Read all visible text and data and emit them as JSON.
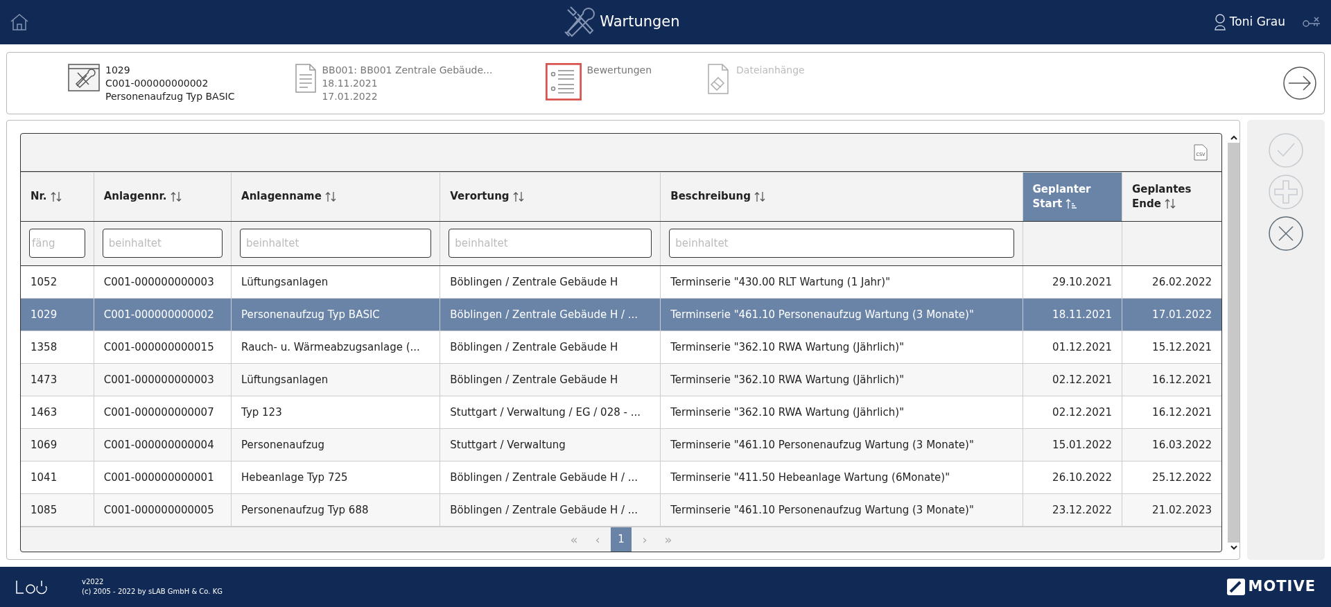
{
  "header": {
    "title": "Wartungen",
    "user": "Toni Grau"
  },
  "info_items": [
    {
      "kind": "record",
      "selected": false,
      "disabled": false,
      "lines": [
        "1029",
        "C001-000000000002",
        "Personenaufzug Typ BASIC"
      ]
    },
    {
      "kind": "document",
      "selected": false,
      "disabled": false,
      "lines": [
        "BB001: BB001 Zentrale Gebäude...",
        "18.11.2021",
        "17.01.2022"
      ]
    },
    {
      "kind": "ratings",
      "selected": true,
      "disabled": false,
      "lines": [
        "Bewertungen"
      ]
    },
    {
      "kind": "attachments",
      "selected": false,
      "disabled": true,
      "lines": [
        "Dateianhänge"
      ]
    }
  ],
  "table": {
    "export_label": "CSV",
    "columns": [
      {
        "label": "Nr.",
        "kind": "text",
        "sorted": false,
        "selected": false,
        "placeholder": "fäng"
      },
      {
        "label": "Anlagennr.",
        "kind": "text",
        "sorted": false,
        "selected": false,
        "placeholder": "beinhaltet"
      },
      {
        "label": "Anlagenname",
        "kind": "text",
        "sorted": false,
        "selected": false,
        "placeholder": "beinhaltet"
      },
      {
        "label": "Verortung",
        "kind": "text",
        "sorted": false,
        "selected": false,
        "placeholder": "beinhaltet"
      },
      {
        "label": "Beschreibung",
        "kind": "text",
        "sorted": false,
        "selected": false,
        "placeholder": "beinhaltet"
      },
      {
        "label": "Geplanter Start",
        "kind": "date",
        "sorted": true,
        "selected": true
      },
      {
        "label": "Geplantes Ende",
        "kind": "date",
        "sorted": false,
        "selected": false
      }
    ],
    "rows": [
      {
        "selected": false,
        "cells": [
          "1052",
          "C001-000000000003",
          "Lüftungsanlagen",
          "Böblingen / Zentrale Gebäude H",
          "Terminserie \"430.00 RLT Wartung (1 Jahr)\"",
          "29.10.2021",
          "26.02.2022"
        ]
      },
      {
        "selected": true,
        "cells": [
          "1029",
          "C001-000000000002",
          "Personenaufzug Typ BASIC",
          "Böblingen / Zentrale Gebäude H / ...",
          "Terminserie \"461.10 Personenaufzug Wartung (3 Monate)\"",
          "18.11.2021",
          "17.01.2022"
        ]
      },
      {
        "selected": false,
        "cells": [
          "1358",
          "C001-000000000015",
          "Rauch- u. Wärmeabzugsanlage (...",
          "Böblingen / Zentrale Gebäude H",
          "Terminserie \"362.10 RWA Wartung (Jährlich)\"",
          "01.12.2021",
          "15.12.2021"
        ]
      },
      {
        "selected": false,
        "cells": [
          "1473",
          "C001-000000000003",
          "Lüftungsanlagen",
          "Böblingen / Zentrale Gebäude H",
          "Terminserie \"362.10 RWA Wartung (Jährlich)\"",
          "02.12.2021",
          "16.12.2021"
        ]
      },
      {
        "selected": false,
        "cells": [
          "1463",
          "C001-000000000007",
          "Typ 123",
          "Stuttgart / Verwaltung / EG / 028 - ...",
          "Terminserie \"362.10 RWA Wartung (Jährlich)\"",
          "02.12.2021",
          "16.12.2021"
        ]
      },
      {
        "selected": false,
        "cells": [
          "1069",
          "C001-000000000004",
          "Personenaufzug",
          "Stuttgart / Verwaltung",
          "Terminserie \"461.10 Personenaufzug Wartung (3 Monate)\"",
          "15.01.2022",
          "16.03.2022"
        ]
      },
      {
        "selected": false,
        "cells": [
          "1041",
          "C001-000000000001",
          "Hebeanlage Typ 725",
          "Böblingen / Zentrale Gebäude H / ...",
          "Terminserie \"411.50 Hebeanlage Wartung (6Monate)\"",
          "26.10.2022",
          "25.12.2022"
        ]
      },
      {
        "selected": false,
        "cells": [
          "1085",
          "C001-000000000005",
          "Personenaufzug Typ 688",
          "Böblingen / Zentrale Gebäude H / ...",
          "Terminserie \"461.10 Personenaufzug Wartung (3 Monate)\"",
          "23.12.2022",
          "21.02.2023"
        ]
      }
    ],
    "pagination": [
      {
        "label": "«",
        "selected": false,
        "disabled": true
      },
      {
        "label": "‹",
        "selected": false,
        "disabled": true
      },
      {
        "label": "1",
        "selected": true,
        "disabled": false
      },
      {
        "label": "›",
        "selected": false,
        "disabled": true
      },
      {
        "label": "»",
        "selected": false,
        "disabled": true
      }
    ]
  },
  "actions": [
    {
      "kind": "confirm",
      "disabled": true
    },
    {
      "kind": "add",
      "disabled": true
    },
    {
      "kind": "cancel",
      "disabled": false
    }
  ],
  "footer": {
    "version": "v2022",
    "copyright": "(c) 2005 - 2022 by sLAB GmbH & Co. KG",
    "brand": "MOTIVE"
  }
}
